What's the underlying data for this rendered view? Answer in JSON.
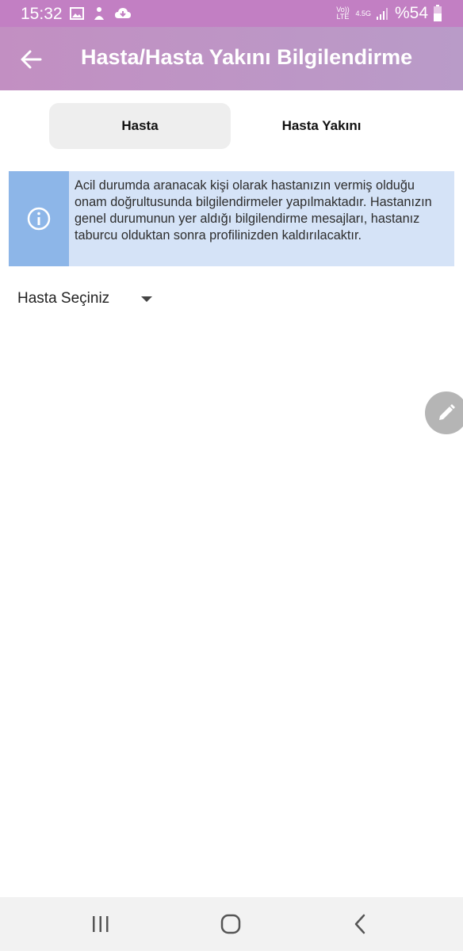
{
  "status_bar": {
    "time": "15:32",
    "volte_label": "Vo)) LTE",
    "network_type": "4.5G",
    "battery": "%54",
    "icons": [
      "image-icon",
      "notification-icon",
      "cloud-sync-icon",
      "signal-icon",
      "battery-icon"
    ]
  },
  "app_bar": {
    "title": "Hasta/Hasta Yakını Bilgilendirme",
    "back_icon": "arrow-left-icon"
  },
  "tabs": [
    {
      "label": "Hasta",
      "selected": true
    },
    {
      "label": "Hasta Yakını",
      "selected": false
    }
  ],
  "info_banner": {
    "icon": "info-icon",
    "text": "Acil durumda aranacak kişi olarak hastanızın vermiş olduğu onam doğrultusunda bilgilendirmeler yapılmaktadır. Hastanızın genel durumunun yer aldığı bilgilendirme mesajları, hastanız taburcu olduktan sonra profilinizden kaldırılacaktır."
  },
  "patient_select": {
    "label": "Hasta Seçiniz",
    "icon": "dropdown-arrow-icon"
  },
  "fab": {
    "icon": "edit-pencil-icon"
  },
  "nav_bar": {
    "icons": [
      "recent-apps-icon",
      "home-icon",
      "back-nav-icon"
    ]
  },
  "colors": {
    "status_bar": "#c27fc3",
    "app_bar": "#bf92c4",
    "info_accent": "#8db6e8",
    "info_background": "#d5e3f7"
  }
}
